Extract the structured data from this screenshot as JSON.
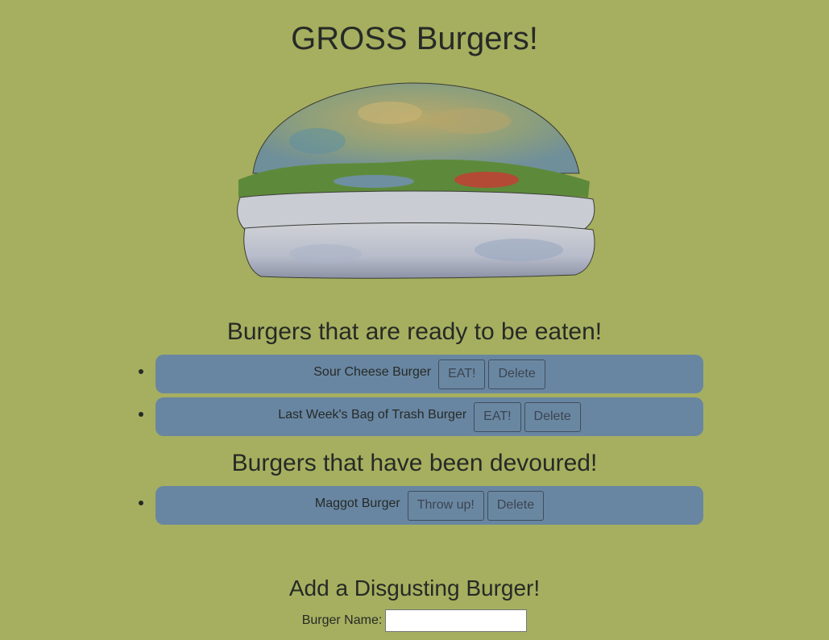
{
  "page": {
    "title": "GROSS Burgers!"
  },
  "hero": {
    "image_name": "moldy-burger-image"
  },
  "ready_section": {
    "heading": "Burgers that are ready to be eaten!",
    "items": [
      {
        "name": "Sour Cheese Burger",
        "eat_label": "EAT!",
        "delete_label": "Delete"
      },
      {
        "name": "Last Week's Bag of Trash Burger",
        "eat_label": "EAT!",
        "delete_label": "Delete"
      }
    ]
  },
  "devoured_section": {
    "heading": "Burgers that have been devoured!",
    "items": [
      {
        "name": "Maggot Burger",
        "throwup_label": "Throw up!",
        "delete_label": "Delete"
      }
    ]
  },
  "form": {
    "heading": "Add a Disgusting Burger!",
    "name_label": "Burger Name:",
    "name_value": ""
  },
  "colors": {
    "background": "#a6af5f",
    "item_background": "#6886a2",
    "text": "#262a26"
  }
}
